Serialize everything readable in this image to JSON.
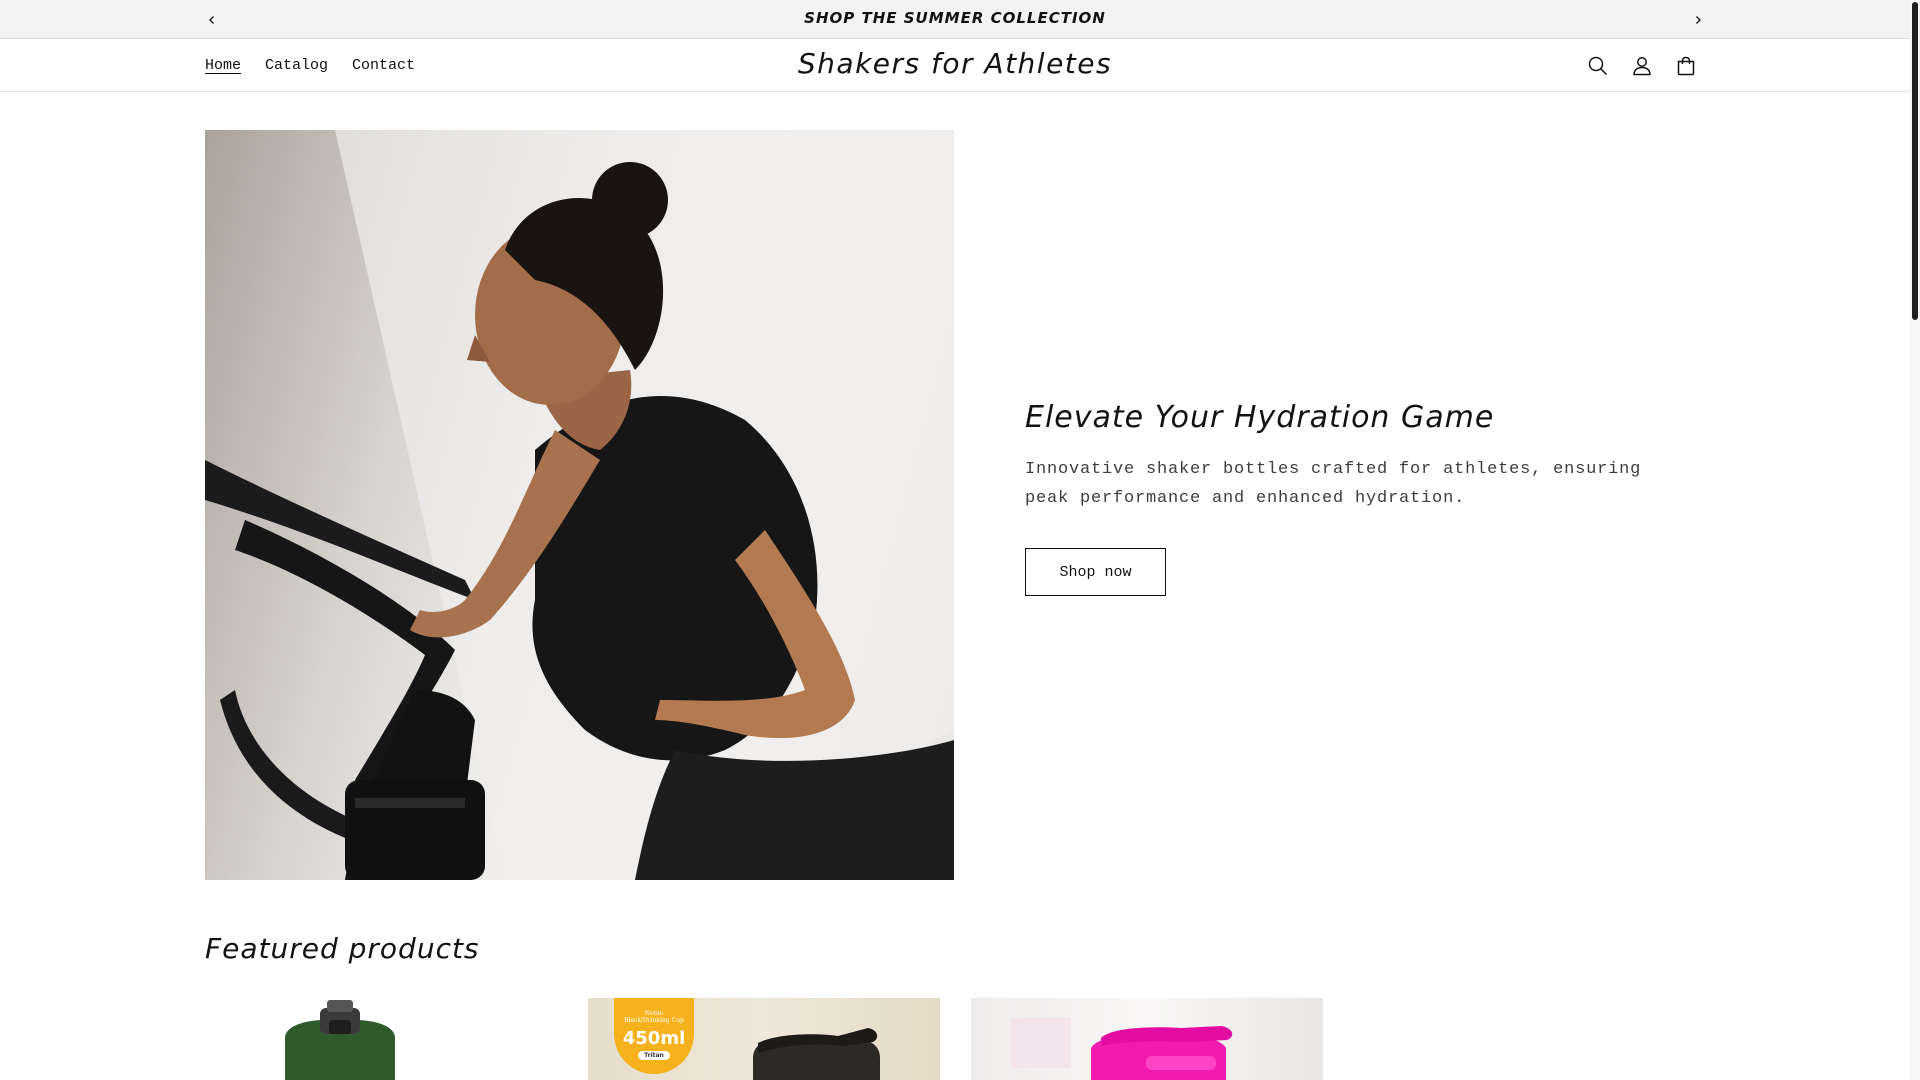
{
  "announcement": {
    "text": "SHOP THE SUMMER COLLECTION",
    "prev_icon": "chevron-left-icon",
    "next_icon": "chevron-right-icon"
  },
  "header": {
    "brand": "Shakers for Athletes",
    "nav": [
      {
        "label": "Home",
        "active": true
      },
      {
        "label": "Catalog",
        "active": false
      },
      {
        "label": "Contact",
        "active": false
      }
    ],
    "icons": [
      "search-icon",
      "account-icon",
      "cart-icon"
    ]
  },
  "hero": {
    "title": "Elevate Your Hydration Game",
    "description": "Innovative shaker bottles crafted for athletes, ensuring peak performance and enhanced hydration.",
    "button_label": "Shop now"
  },
  "featured": {
    "title": "Featured products",
    "products": [
      {
        "image": "green-shaker-bottle"
      },
      {
        "image": "black-shaker-bottle",
        "badge_sub": "Noble Black/Drinking Cup",
        "badge_size": "450ml",
        "badge_material": "Tritan"
      },
      {
        "image": "pink-shaker-bottle"
      }
    ]
  },
  "colors": {
    "announcement_bg": "#f3f3f3",
    "text": "#121212",
    "badge": "#f5b21d",
    "pink_shaker": "#f21bb0",
    "green_shaker": "#2f5a2c"
  }
}
